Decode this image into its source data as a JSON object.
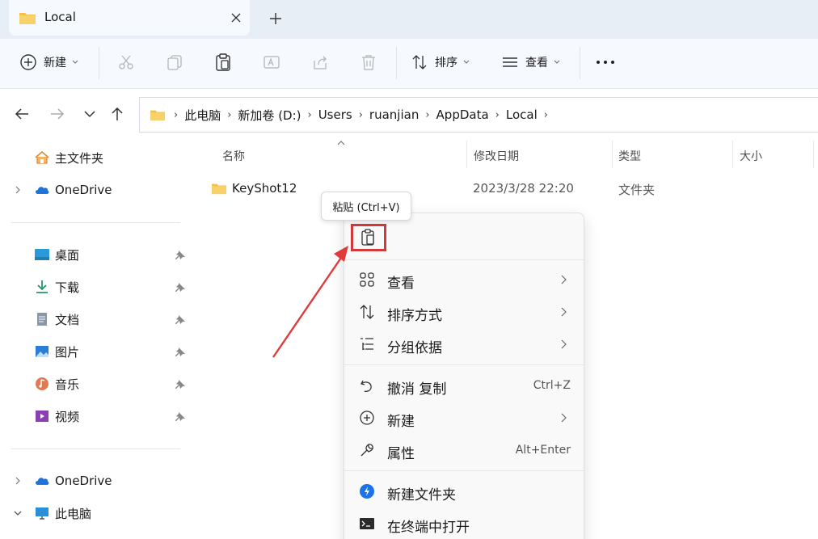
{
  "tab": {
    "title": "Local"
  },
  "toolbar": {
    "new_label": "新建",
    "sort_label": "排序",
    "view_label": "查看"
  },
  "breadcrumb": [
    "此电脑",
    "新加卷 (D:)",
    "Users",
    "ruanjian",
    "AppData",
    "Local"
  ],
  "sidebar": {
    "home": "主文件夹",
    "onedrive_top": "OneDrive",
    "quick": [
      "桌面",
      "下载",
      "文档",
      "图片",
      "音乐",
      "视频"
    ],
    "onedrive": "OneDrive",
    "this_pc": "此电脑"
  },
  "columns": {
    "name": "名称",
    "modified": "修改日期",
    "type": "类型",
    "size": "大小"
  },
  "files": [
    {
      "name": "KeyShot12",
      "modified": "2023/3/28 22:20",
      "type": "文件夹"
    }
  ],
  "tooltip": "粘贴 (Ctrl+V)",
  "menu": {
    "view": "查看",
    "sort_by": "排序方式",
    "group_by": "分组依据",
    "undo": "撤消 复制",
    "undo_shortcut": "Ctrl+Z",
    "new": "新建",
    "properties": "属性",
    "properties_shortcut": "Alt+Enter",
    "new_folder": "新建文件夹",
    "open_terminal": "在终端中打开"
  },
  "colors": {
    "highlight_box": "#d23a3a",
    "arrow": "#e03a3a",
    "folder": "#f3c14b",
    "accent": "#1a73e8"
  },
  "icons": [
    "folder-icon",
    "close-icon",
    "plus-icon",
    "cut-icon",
    "copy-icon",
    "paste-icon",
    "rename-icon",
    "share-icon",
    "delete-icon",
    "sort-icon",
    "view-icon",
    "more-icon",
    "back-icon",
    "forward-icon",
    "recent-icon",
    "up-icon",
    "home-icon",
    "cloud-icon",
    "desktop-icon",
    "download-icon",
    "document-icon",
    "picture-icon",
    "music-icon",
    "video-icon",
    "pin-icon",
    "pc-icon",
    "grid-icon",
    "group-icon",
    "undo-icon",
    "wrench-icon",
    "new-folder-icon",
    "terminal-icon"
  ]
}
